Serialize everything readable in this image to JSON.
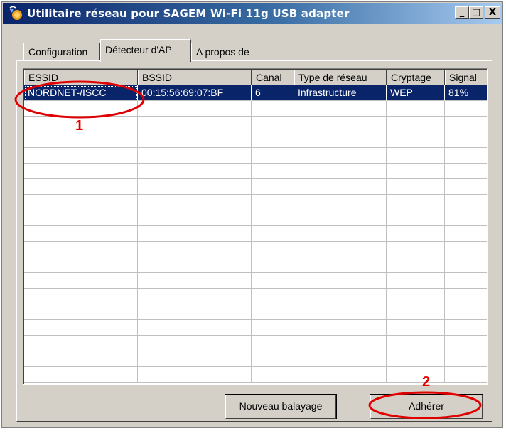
{
  "window": {
    "title": "Utilitaire réseau pour SAGEM Wi-Fi 11g USB adapter",
    "icon": "wifi-app-icon",
    "controls": {
      "minimize": "_",
      "maximize": "□",
      "close": "X"
    }
  },
  "tabs": [
    {
      "label": "Configuration",
      "active": false
    },
    {
      "label": "Détecteur d'AP",
      "active": true
    },
    {
      "label": "A propos de",
      "active": false
    }
  ],
  "table": {
    "columns": [
      "ESSID",
      "BSSID",
      "Canal",
      "Type de réseau",
      "Cryptage",
      "Signal"
    ],
    "rows": [
      {
        "essid": "NORDNET-/ISCC",
        "bssid": "00:15:56:69:07:BF",
        "canal": "6",
        "type": "Infrastructure",
        "cryptage": "WEP",
        "signal": "81%",
        "selected": true
      }
    ]
  },
  "buttons": {
    "scan": "Nouveau balayage",
    "join": "Adhérer"
  },
  "annotations": {
    "marker1": "1",
    "marker2": "2",
    "color": "#e00000"
  },
  "colors": {
    "selection": "#0a246a",
    "face": "#d4d0c8"
  }
}
